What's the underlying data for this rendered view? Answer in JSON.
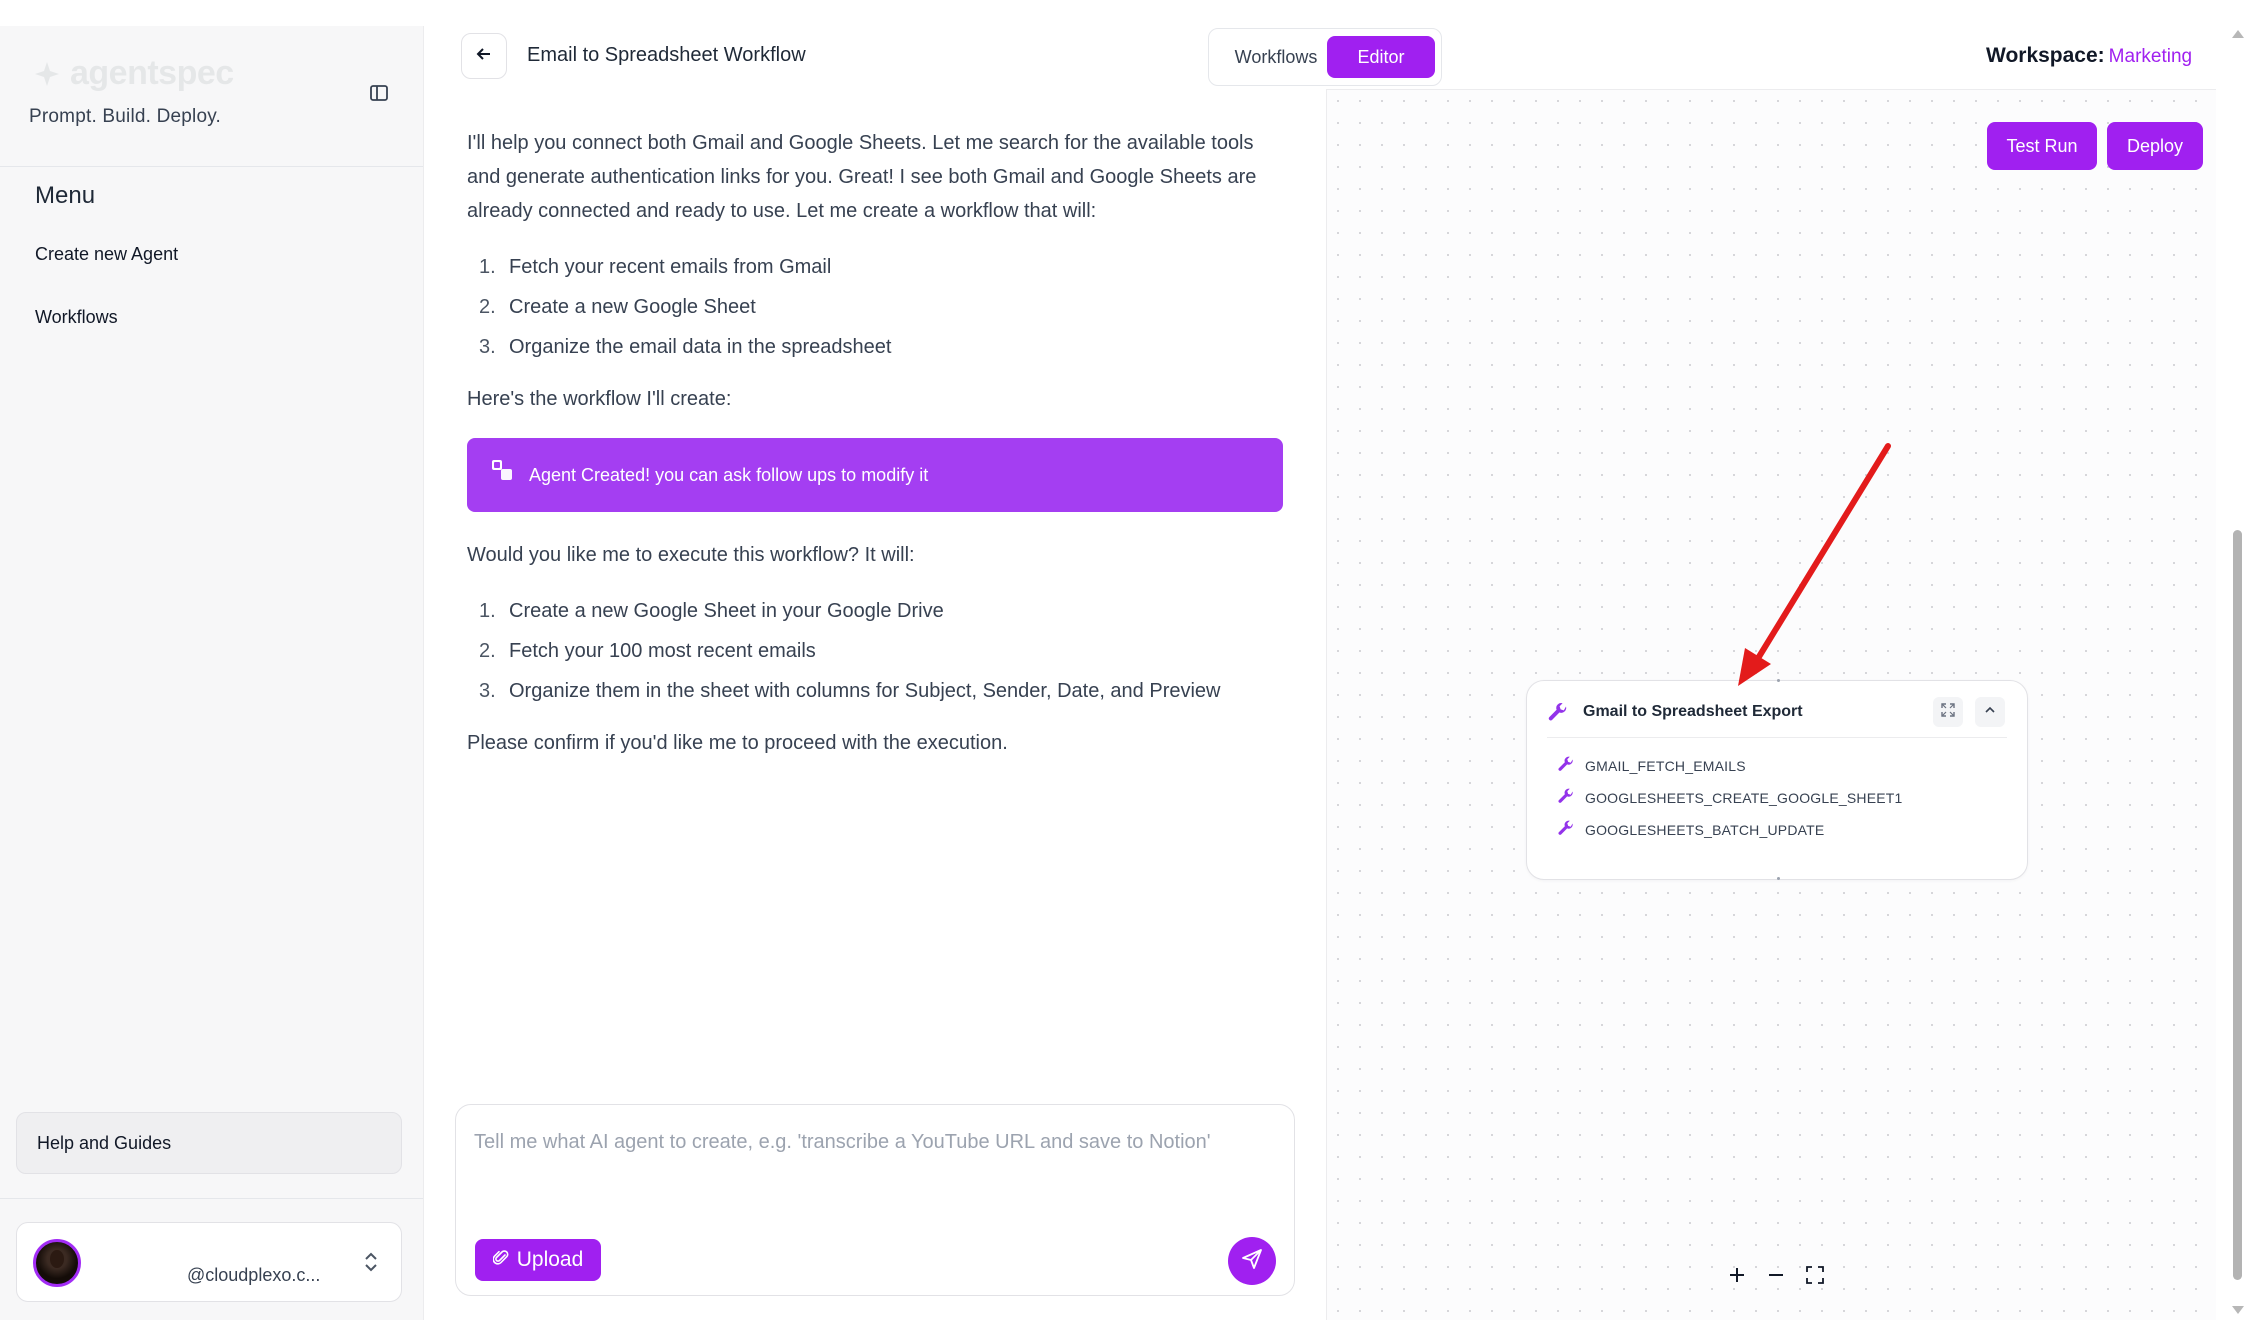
{
  "sidebar": {
    "brand_name": "agentspec",
    "tagline": "Prompt. Build. Deploy.",
    "menu_heading": "Menu",
    "items": [
      {
        "label": "Create new Agent"
      },
      {
        "label": "Workflows"
      }
    ],
    "help_label": "Help and Guides",
    "user_email": "@cloudplexo.c..."
  },
  "chat": {
    "title": "Email to Spreadsheet Workflow",
    "tabs": {
      "workflows": "Workflows",
      "editor": "Editor"
    },
    "intro": "I'll help you connect both Gmail and Google Sheets. Let me search for the available tools and generate authentication links for you. Great! I see both Gmail and Google Sheets are already connected and ready to use. Let me create a workflow that will:",
    "steps": [
      "Fetch your recent emails from Gmail",
      "Create a new Google Sheet",
      "Organize the email data in the spreadsheet"
    ],
    "workflow_line": "Here's the workflow I'll create:",
    "banner": "Agent Created! you can ask follow ups to modify it",
    "execute_question": "Would you like me to execute this workflow? It will:",
    "execute_steps": [
      "Create a new Google Sheet in your Google Drive",
      "Fetch your 100 most recent emails",
      "Organize them in the sheet with columns for Subject, Sender, Date, and Preview"
    ],
    "confirm": "Please confirm if you'd like me to proceed with the execution.",
    "input_placeholder": "Tell me what AI agent to create, e.g. 'transcribe a YouTube URL and save to Notion'",
    "upload_label": "Upload"
  },
  "workspace": {
    "label": "Workspace:",
    "value": "Marketing"
  },
  "canvas": {
    "test_run_label": "Test Run",
    "deploy_label": "Deploy",
    "node": {
      "title": "Gmail to Spreadsheet Export",
      "tools": [
        "GMAIL_FETCH_EMAILS",
        "GOOGLESHEETS_CREATE_GOOGLE_SHEET1",
        "GOOGLESHEETS_BATCH_UPDATE"
      ]
    }
  },
  "colors": {
    "accent": "#a020f0",
    "annotation_arrow": "#e31b1b"
  }
}
